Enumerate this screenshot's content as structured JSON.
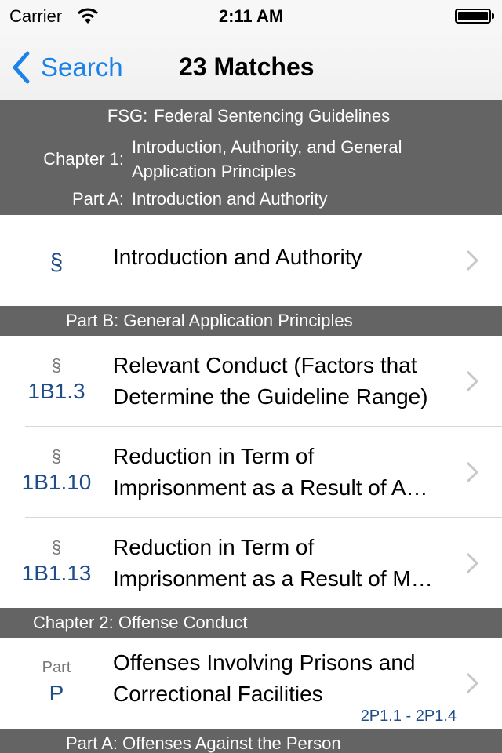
{
  "status_bar": {
    "carrier": "Carrier",
    "time": "2:11 AM",
    "wifi_icon": "wifi-icon",
    "battery_icon": "battery-full-icon",
    "battery_level": 1.0
  },
  "nav": {
    "back_label": "Search",
    "back_icon": "chevron-left-icon",
    "title": "23 Matches"
  },
  "colors": {
    "accent": "#1a82e8",
    "section_number": "#1f4d8a",
    "header_bg": "#646464"
  },
  "header_block": {
    "book_key": "FSG:",
    "book_val": "Federal Sentencing Guidelines",
    "chapter_key": "Chapter 1:",
    "chapter_val_line1": "Introduction, Authority, and General",
    "chapter_val_line2": "Application Principles",
    "part_key": "Part A:",
    "part_val": "Introduction and Authority"
  },
  "rows": [
    {
      "symbol": "§",
      "number": "",
      "title": "Introduction and Authority"
    },
    {
      "symbol": "§",
      "number": "1B1.3",
      "title_line1": "Relevant Conduct (Factors that",
      "title_line2": "Determine the Guideline Range)"
    },
    {
      "symbol": "§",
      "number": "1B1.10",
      "title_line1": "Reduction in Term of",
      "title_line2": "Imprisonment as a Result of A…"
    },
    {
      "symbol": "§",
      "number": "1B1.13",
      "title_line1": "Reduction in Term of",
      "title_line2": "Imprisonment as a Result of M…"
    },
    {
      "symbol": "Part",
      "number": "P",
      "title_line1": "Offenses Involving Prisons and",
      "title_line2": "Correctional Facilities",
      "range": "2P1.1 - 2P1.4"
    }
  ],
  "section_headers": {
    "part_b": "Part B: General Application Principles",
    "chapter_2": "Chapter 2: Offense Conduct",
    "part_a_person": "Part A: Offenses Against the Person"
  }
}
